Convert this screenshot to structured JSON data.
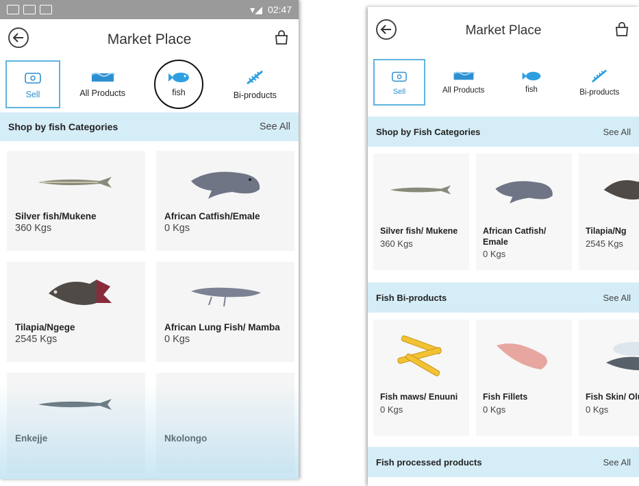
{
  "left": {
    "status_time": "02:47",
    "title": "Market Place",
    "tabs": [
      "Sell",
      "All Products",
      "fish",
      "Bi-products"
    ],
    "section_title": "Shop by  fish Categories",
    "see_all": "See All",
    "products": [
      {
        "name": "Silver fish/Mukene",
        "qty": "360 Kgs"
      },
      {
        "name": "African Catfish/Emale",
        "qty": "0 Kgs"
      },
      {
        "name": "Tilapia/Ngege",
        "qty": "2545 Kgs"
      },
      {
        "name": "African Lung Fish/ Mamba",
        "qty": "0 Kgs"
      },
      {
        "name": "Enkejje",
        "qty": ""
      },
      {
        "name": "Nkolongo",
        "qty": ""
      }
    ]
  },
  "right": {
    "title": "Market Place",
    "tabs": [
      "Sell",
      "All Products",
      "fish",
      "Bi-products"
    ],
    "sections": [
      {
        "title": "Shop by Fish Categories",
        "see_all": "See All"
      },
      {
        "title": "Fish Bi-products",
        "see_all": "See All"
      },
      {
        "title": "Fish processed products",
        "see_all": "See All"
      }
    ],
    "categories": [
      {
        "name": "Silver fish/ Mukene",
        "qty": "360 Kgs"
      },
      {
        "name": "African Catfish/ Emale",
        "qty": "0 Kgs"
      },
      {
        "name": "Tilapia/Ng",
        "qty": "2545 Kgs"
      }
    ],
    "biproducts": [
      {
        "name": "Fish maws/ Enuuni",
        "qty": "0 Kgs"
      },
      {
        "name": "Fish Fillets",
        "qty": "0 Kgs"
      },
      {
        "name": "Fish Skin/ Oluliba",
        "qty": "0 Kgs"
      }
    ]
  },
  "colors": {
    "accent": "#2d8fd1",
    "section_bg": "#d5edf7",
    "statusbar": "#9a9a9a"
  },
  "icons": [
    "back-arrow-icon",
    "shopping-bag-icon",
    "sell-icon",
    "all-products-icon",
    "fish-icon",
    "bi-products-icon"
  ]
}
